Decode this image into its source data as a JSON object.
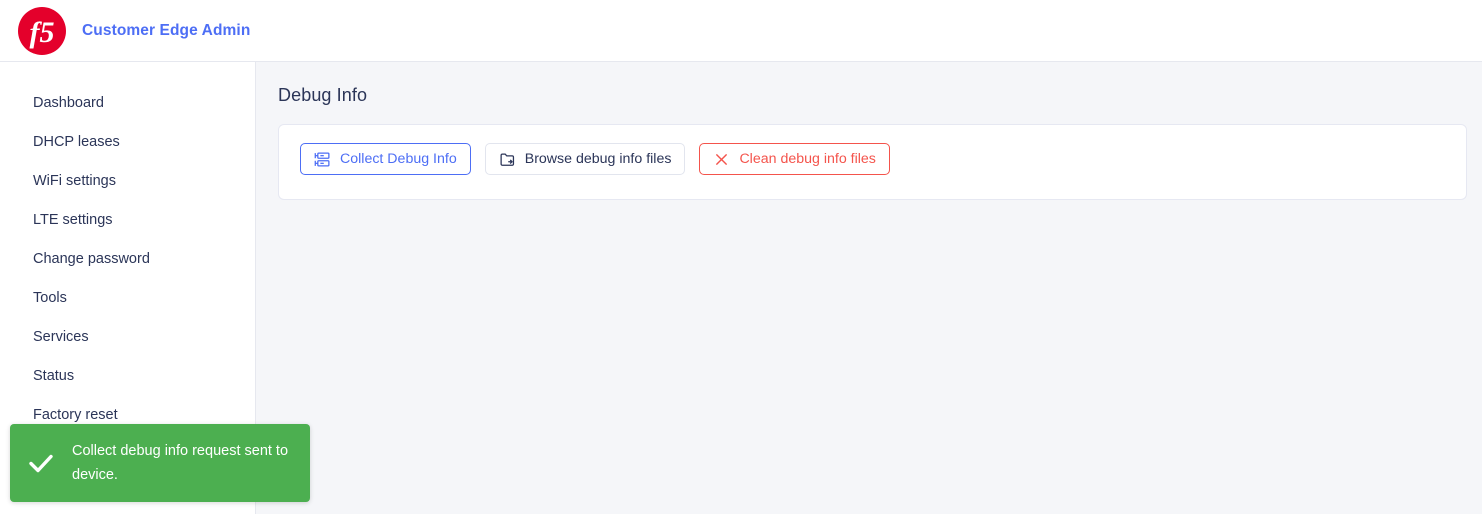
{
  "header": {
    "logo_icon": "f5-logo-icon",
    "logo_text": "f5",
    "title": "Customer Edge Admin",
    "title_color": "#4d6ef5",
    "logo_color": "#e4002b"
  },
  "sidebar": {
    "items": [
      {
        "label": "Dashboard"
      },
      {
        "label": "DHCP leases"
      },
      {
        "label": "WiFi settings"
      },
      {
        "label": "LTE settings"
      },
      {
        "label": "Change password"
      },
      {
        "label": "Tools"
      },
      {
        "label": "Services"
      },
      {
        "label": "Status"
      },
      {
        "label": "Factory reset"
      }
    ]
  },
  "main": {
    "page_title": "Debug Info",
    "buttons": [
      {
        "label": "Collect Debug Info",
        "icon": "server-rack-icon",
        "style": "primary",
        "color": "#4d6ef5"
      },
      {
        "label": "Browse debug info files",
        "icon": "folder-arrow-icon",
        "style": "neutral",
        "color": "#2b3558"
      },
      {
        "label": "Clean debug info files",
        "icon": "close-x-icon",
        "style": "danger",
        "color": "#f4544c"
      }
    ]
  },
  "toast": {
    "icon": "checkmark-icon",
    "message": "Collect debug info request sent to device.",
    "background_color": "#4caf50",
    "text_color": "#ffffff"
  }
}
